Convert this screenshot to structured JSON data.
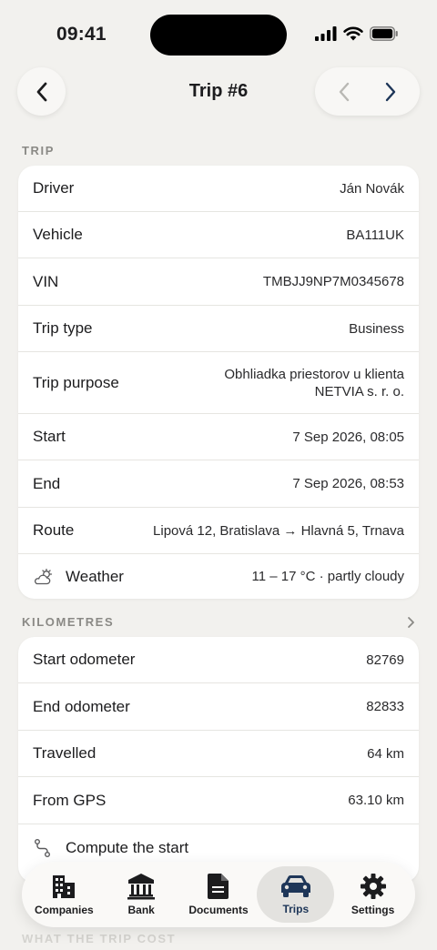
{
  "status_bar": {
    "time": "09:41"
  },
  "nav": {
    "title": "Trip #6"
  },
  "trip_section": {
    "header": "TRIP",
    "rows": [
      {
        "label": "Driver",
        "value": "Ján Novák"
      },
      {
        "label": "Vehicle",
        "value": "BA111UK"
      },
      {
        "label": "VIN",
        "value": "TMBJJ9NP7M0345678"
      },
      {
        "label": "Trip type",
        "value": "Business"
      },
      {
        "label": "Trip purpose",
        "value_line1": "Obhliadka priestorov u klienta",
        "value_line2": "NETVIA s. r. o."
      },
      {
        "label": "Start",
        "value": "7 Sep 2026, 08:05"
      },
      {
        "label": "End",
        "value": "7 Sep 2026, 08:53"
      },
      {
        "label": "Route",
        "value": "Lipová 12, Bratislava → Hlavná 5, Trnava"
      },
      {
        "label": "Weather",
        "value": "11 – 17 °C · partly cloudy",
        "icon": "partly-cloudy-icon"
      }
    ]
  },
  "km_section": {
    "header": "KILOMETRES",
    "rows": [
      {
        "label": "Start odometer",
        "value": "82769"
      },
      {
        "label": "End odometer",
        "value": "82833"
      },
      {
        "label": "Travelled",
        "value": "64 km"
      },
      {
        "label": "From GPS",
        "value": "63.10 km"
      },
      {
        "label": "Compute the start",
        "icon": "route-icon"
      }
    ]
  },
  "cost_section": {
    "header": "WHAT THE TRIP COST"
  },
  "tab_bar": {
    "active": "Trips",
    "accent": "#1e3658",
    "tabs": [
      {
        "label": "Companies",
        "icon": "building-icon"
      },
      {
        "label": "Bank",
        "icon": "bank-icon"
      },
      {
        "label": "Documents",
        "icon": "document-icon"
      },
      {
        "label": "Trips",
        "icon": "car-icon"
      },
      {
        "label": "Settings",
        "icon": "gear-icon"
      }
    ]
  }
}
